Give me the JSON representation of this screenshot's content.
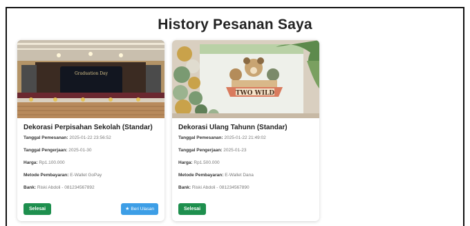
{
  "page": {
    "title": "History Pesanan Saya"
  },
  "labels": {
    "order_date": "Tanggal Pemesanan:",
    "work_date": "Tanggal Pengerjaan:",
    "price": "Harga:",
    "payment_method": "Metode Pembayaran:",
    "bank": "Bank:"
  },
  "orders": [
    {
      "title": "Dekorasi Perpisahan Sekolah (Standar)",
      "order_date": "2025-01-22 23:56:52",
      "work_date": "2025-01-30",
      "price": "Rp1.100.000",
      "payment_method": "E-Wallet GoPay",
      "bank": "Riski Abdoli - 081234567892",
      "status_label": "Selesai",
      "review_label": "Beri Ulasan",
      "image_text": "Graduation Day"
    },
    {
      "title": "Dekorasi Ulang Tahunn (Standar)",
      "order_date": "2025-01-22 21:49:02",
      "work_date": "2025-01-23",
      "price": "Rp1.500.000",
      "payment_method": "E-Wallet Dana",
      "bank": "Riski Abdoli - 081234567890",
      "status_label": "Selesai",
      "image_text": "TWO WILD"
    }
  ],
  "colors": {
    "status_button": "#1e8f4e",
    "review_button": "#3d9ee6"
  },
  "icons": {
    "review": "star-icon"
  }
}
